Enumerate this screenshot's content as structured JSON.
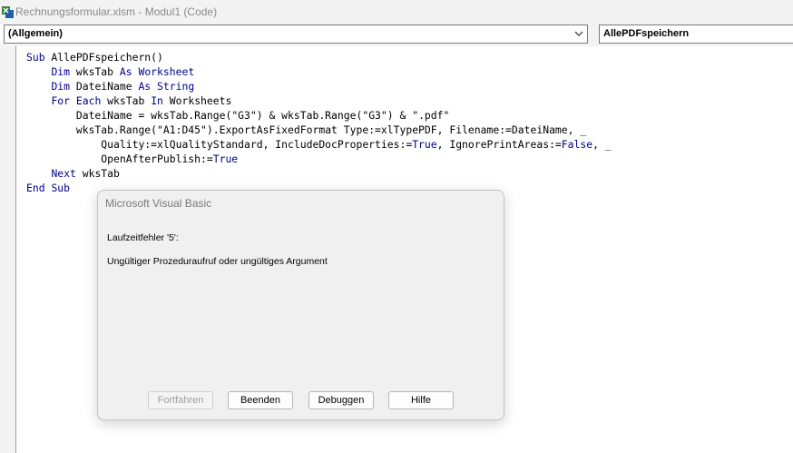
{
  "window": {
    "title": "Rechnungsformular.xlsm - Modul1 (Code)"
  },
  "toolbar": {
    "object_combo": "(Allgemein)",
    "procedure_combo": "AllePDFspeichern"
  },
  "code": {
    "lines": [
      "Sub AllePDFspeichern()",
      "    Dim wksTab As Worksheet",
      "    Dim DateiName As String",
      "    For Each wksTab In Worksheets",
      "        DateiName = wksTab.Range(\"G3\") & wksTab.Range(\"G3\") & \".pdf\"",
      "        wksTab.Range(\"A1:D45\").ExportAsFixedFormat Type:=xlTypePDF, Filename:=DateiName, _",
      "            Quality:=xlQualityStandard, IncludeDocProperties:=True, IgnorePrintAreas:=False, _",
      "            OpenAfterPublish:=True",
      "    Next wksTab",
      "End Sub"
    ]
  },
  "dialog": {
    "title": "Microsoft Visual Basic",
    "error_code": "Laufzeitfehler '5':",
    "error_message": "Ungültiger Prozeduraufruf oder ungültiges Argument",
    "buttons": {
      "continue": "Fortfahren",
      "end": "Beenden",
      "debug": "Debuggen",
      "help": "Hilfe"
    }
  },
  "colors": {
    "keyword": "#00008b"
  }
}
